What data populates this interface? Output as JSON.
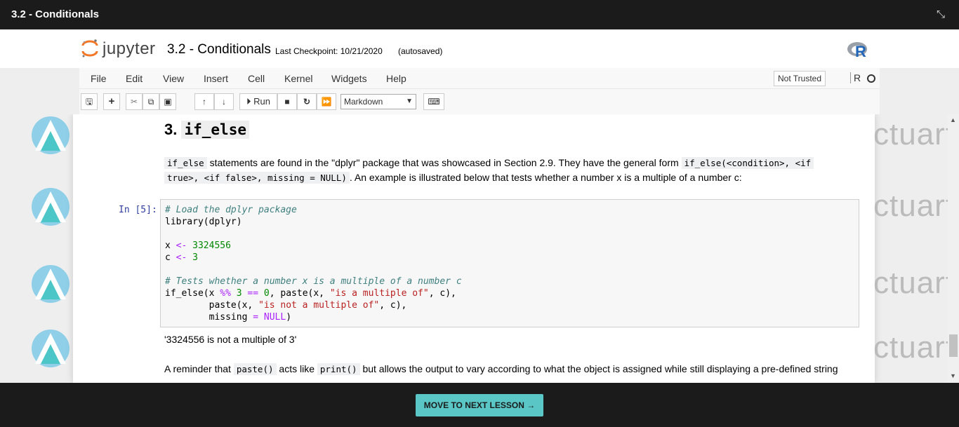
{
  "window": {
    "title": "3.2 - Conditionals"
  },
  "header": {
    "logo_text": "jupyter",
    "notebook_name": "3.2 - Conditionals",
    "checkpoint": "Last Checkpoint: 10/21/2020",
    "autosaved": "(autosaved)"
  },
  "menu": {
    "items": [
      "File",
      "Edit",
      "View",
      "Insert",
      "Cell",
      "Kernel",
      "Widgets",
      "Help"
    ],
    "not_trusted": "Not Trusted",
    "kernel": "R"
  },
  "toolbar": {
    "run_label": "Run",
    "cell_type": "Markdown"
  },
  "content": {
    "heading_num": "3.",
    "heading_code": "if_else",
    "para1": {
      "c1": "if_else",
      "t1": " statements are found in the \"dplyr\" package that was showcased in Section 2.9. They have the general form ",
      "c2a": "if_else(<condition>, <if",
      "c2b": "true>, <if false>, missing = NULL)",
      "t2": ". An example is illustrated below that tests whether a number x is a multiple of a number c:"
    },
    "prompt": "In [5]:",
    "code": {
      "l1": "# Load the dplyr package",
      "l2": "library(dplyr)",
      "l3a": "x ",
      "l3op": "<-",
      "l3n": " 3324556",
      "l4a": "c ",
      "l4op": "<-",
      "l4n": " 3",
      "l5": "# Tests whether a number x is a multiple of a number c",
      "l6a": "if_else(x ",
      "l6op": "%%",
      "l6n": " 3",
      "l6op2": " ==",
      "l6n2": " 0",
      "l6b": ", paste(x, ",
      "l6s": "\"is a multiple of\"",
      "l6c": ", c),",
      "l7a": "        paste(x, ",
      "l7s": "\"is not a multiple of\"",
      "l7c": ", c),",
      "l8a": "        missing ",
      "l8op": "=",
      "l8k": " NULL",
      "l8c": ")"
    },
    "output": "'3324556 is not a multiple of 3'",
    "para2": {
      "t1": "A reminder that ",
      "c1": "paste()",
      "t2": " acts like ",
      "c2": "print()",
      "t3": " but allows the output to vary according to what the object is assigned while still displaying a pre-defined string"
    },
    "watermark_text": "ctuart"
  },
  "footer": {
    "next_label": "MOVE TO NEXT LESSON →"
  },
  "colors": {
    "accent": "#5ac6c6",
    "dark": "#1b1b1b"
  }
}
